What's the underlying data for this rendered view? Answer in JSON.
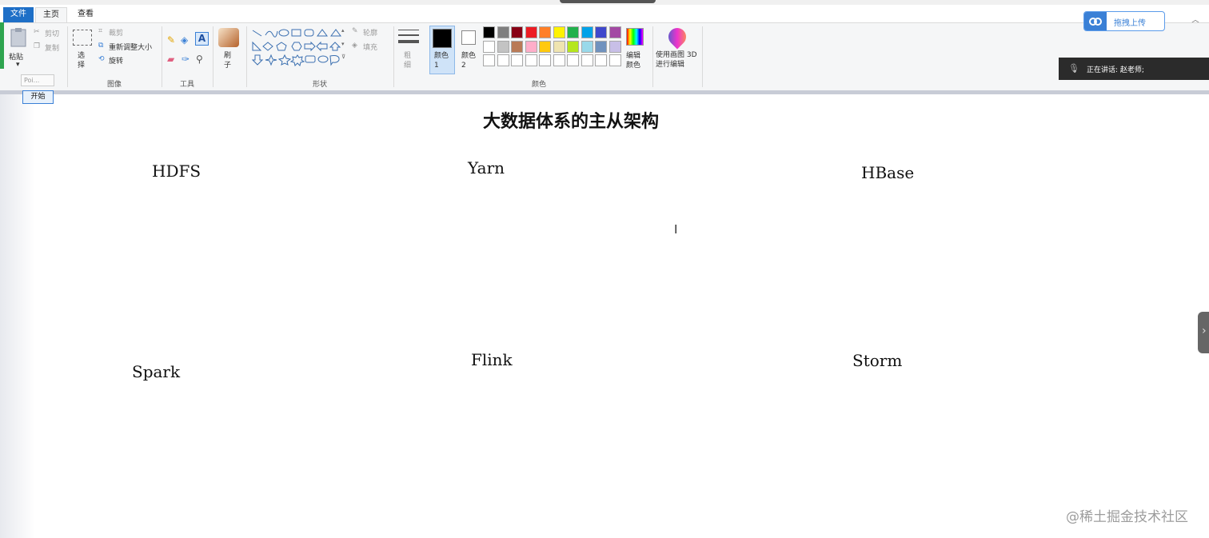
{
  "menu": {
    "file": "文件",
    "home": "主页",
    "view": "查看"
  },
  "clipboard": {
    "paste": "粘贴",
    "cut": "剪切",
    "copy": "复制",
    "group_label": ""
  },
  "image_group": {
    "select": "选择",
    "crop": "裁剪",
    "resize": "重新调整大小",
    "rotate": "旋转",
    "label": "图像"
  },
  "tools_group": {
    "label": "工具"
  },
  "brush": {
    "label": "刷子"
  },
  "shapes_group": {
    "outline": "轮廓",
    "fill": "填充",
    "label": "形状"
  },
  "size": {
    "label": "粗细"
  },
  "colors_group": {
    "color1": "颜色 1",
    "color2": "颜色 2",
    "edit_colors": "编辑颜色",
    "label": "颜色",
    "palette": [
      "#000000",
      "#7f7f7f",
      "#880015",
      "#ed1c24",
      "#ff7f27",
      "#fff200",
      "#22b14c",
      "#00a2e8",
      "#3f48cc",
      "#a349a4",
      "#ffffff",
      "#c3c3c3",
      "#b97a57",
      "#ffaec9",
      "#ffc90e",
      "#efe4b0",
      "#b5e61d",
      "#99d9ea",
      "#7092be",
      "#c8bfe7",
      "#ffffff",
      "#ffffff",
      "#ffffff",
      "#ffffff",
      "#ffffff",
      "#ffffff",
      "#ffffff",
      "#ffffff",
      "#ffffff",
      "#ffffff"
    ]
  },
  "paint3d": {
    "label": "使用画图 3D 进行编辑"
  },
  "tooltip": {
    "text": "Poi..."
  },
  "start": {
    "label": "开始"
  },
  "upload": {
    "label": "拖拽上传"
  },
  "talking": {
    "label": "正在讲话: 赵老师;"
  },
  "canvas": {
    "title": "大数据体系的主从架构",
    "labels": [
      "HDFS",
      "Yarn",
      "HBase",
      "Spark",
      "Flink",
      "Storm"
    ]
  },
  "watermark": "@稀土掘金技术社区"
}
